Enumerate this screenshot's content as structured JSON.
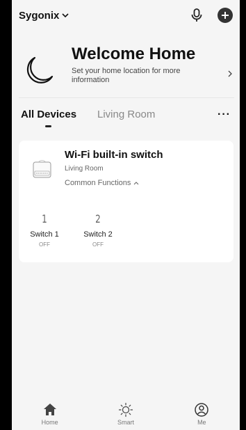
{
  "header": {
    "home_name": "Sygonix",
    "icons": [
      "chevron-down-icon",
      "microphone-icon",
      "plus-icon"
    ]
  },
  "welcome": {
    "title": "Welcome Home",
    "subtitle": "Set your home location for more information",
    "icons": [
      "moon-icon",
      "chevron-right-icon"
    ]
  },
  "tabs": [
    {
      "label": "All Devices",
      "active": true
    },
    {
      "label": "Living Room",
      "active": false
    }
  ],
  "device": {
    "name": "Wi-Fi built-in switch",
    "room": "Living Room",
    "common_functions": "Common Functions",
    "switches": [
      {
        "number": "1",
        "label": "Switch 1",
        "state": "OFF"
      },
      {
        "number": "2",
        "label": "Switch 2",
        "state": "OFF"
      }
    ]
  },
  "bottom_nav": [
    {
      "label": "Home",
      "icon": "home-icon",
      "active": true
    },
    {
      "label": "Smart",
      "icon": "sun-icon",
      "active": false
    },
    {
      "label": "Me",
      "icon": "user-icon",
      "active": false
    }
  ],
  "colors": {
    "background": "#f5f5f5",
    "card": "#ffffff",
    "text": "#111111"
  }
}
